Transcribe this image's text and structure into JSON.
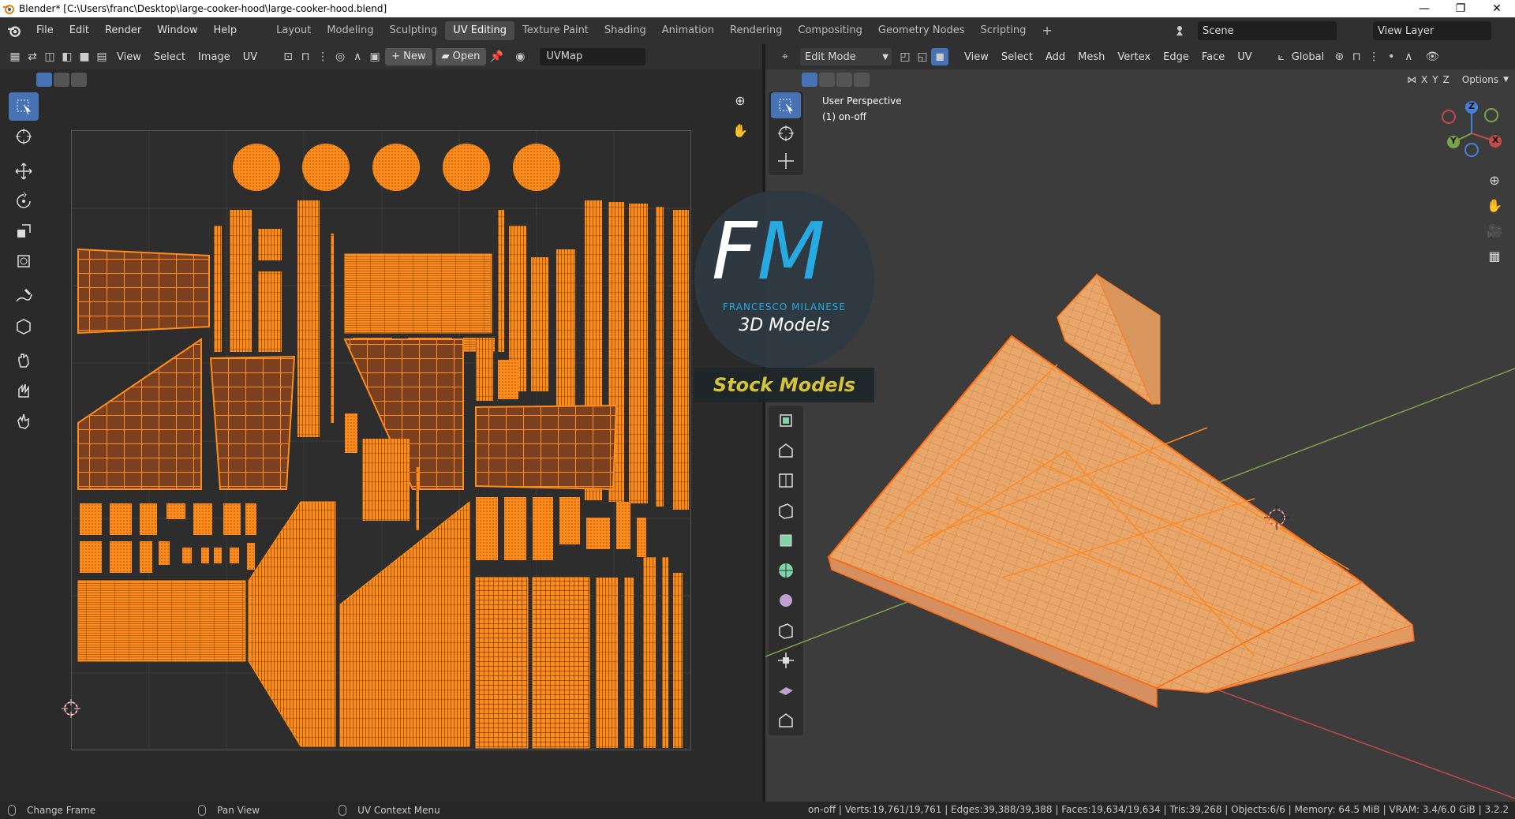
{
  "window": {
    "title": "Blender* [C:\\Users\\franc\\Desktop\\large-cooker-hood\\large-cooker-hood.blend]",
    "controls": [
      "—",
      "❐",
      "✕"
    ]
  },
  "menu": {
    "items": [
      "File",
      "Edit",
      "Render",
      "Window",
      "Help"
    ]
  },
  "workspaces": {
    "tabs": [
      "Layout",
      "Modeling",
      "Sculpting",
      "UV Editing",
      "Texture Paint",
      "Shading",
      "Animation",
      "Rendering",
      "Compositing",
      "Geometry Nodes",
      "Scripting"
    ],
    "active": "UV Editing",
    "add": "+"
  },
  "scene": {
    "name": "Scene"
  },
  "view_layer": {
    "name": "View Layer"
  },
  "uv_editor": {
    "menus": [
      "View",
      "Select",
      "Image",
      "UV"
    ],
    "new_label": "New",
    "open_label": "Open",
    "uvmap": "UVMap"
  },
  "viewport": {
    "mode": "Edit Mode",
    "menus": [
      "View",
      "Select",
      "Add",
      "Mesh",
      "Vertex",
      "Edge",
      "Face",
      "UV"
    ],
    "transform": "Global",
    "options": "Options",
    "axes": [
      "X",
      "Y",
      "Z"
    ],
    "perspective": "User Perspective",
    "object": "(1) on-off"
  },
  "logo": {
    "initials_f": "F",
    "initials_m": "M",
    "name": "FRANCESCO MILANESE",
    "tagline": "3D Models",
    "banner": "Stock Models"
  },
  "gizmo": {
    "x": "X",
    "y": "Y",
    "z": "Z"
  },
  "status": {
    "left": "Change Frame",
    "middle": "Pan View",
    "right": "UV Context Menu",
    "stats": "on-off | Verts:19,761/19,761 | Edges:39,388/39,388 | Faces:19,634/19,634 | Tris:39,268 | Objects:6/6 | Memory: 64.5 MiB | VRAM: 3.4/6.0 GiB | 3.2.2"
  },
  "colors": {
    "uv_orange": "#ff8c1a",
    "select_blue": "#4772b3",
    "mesh_orange": "#f0a050"
  }
}
